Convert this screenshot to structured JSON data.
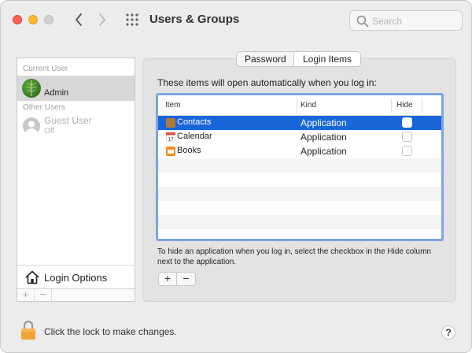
{
  "window": {
    "title": "Users & Groups",
    "search_placeholder": "Search"
  },
  "sidebar": {
    "current_user_header": "Current User",
    "current_user": {
      "name": "Admin"
    },
    "other_users_header": "Other Users",
    "other_users": [
      {
        "name": "Guest User",
        "status": "Off"
      }
    ],
    "login_options_label": "Login Options",
    "footer_buttons": [
      "+",
      "−"
    ]
  },
  "tabs": [
    {
      "label": "Password",
      "selected": false
    },
    {
      "label": "Login Items",
      "selected": true
    }
  ],
  "login_items": {
    "intro": "These items will open automatically when you log in:",
    "columns": [
      "Item",
      "Kind",
      "Hide"
    ],
    "rows": [
      {
        "name": "Contacts",
        "kind": "Application",
        "hide": false,
        "selected": true,
        "icon": "contacts-icon",
        "icon_color": "#b07a3c"
      },
      {
        "name": "Calendar",
        "kind": "Application",
        "hide": false,
        "selected": false,
        "icon": "calendar-icon",
        "icon_color": "#e94b3c"
      },
      {
        "name": "Books",
        "kind": "Application",
        "hide": false,
        "selected": false,
        "icon": "books-icon",
        "icon_color": "#f28a1e"
      }
    ],
    "hint": "To hide an application when you log in, select the checkbox in the Hide column next to the application.",
    "add_label": "+",
    "remove_label": "−"
  },
  "footer": {
    "lock_text": "Click the lock to make changes.",
    "help_label": "?"
  },
  "colors": {
    "selection": "#1866d8",
    "focus_ring": "#7da4e6",
    "traffic_close": "#fe5f57",
    "traffic_minimize": "#febc2e"
  }
}
